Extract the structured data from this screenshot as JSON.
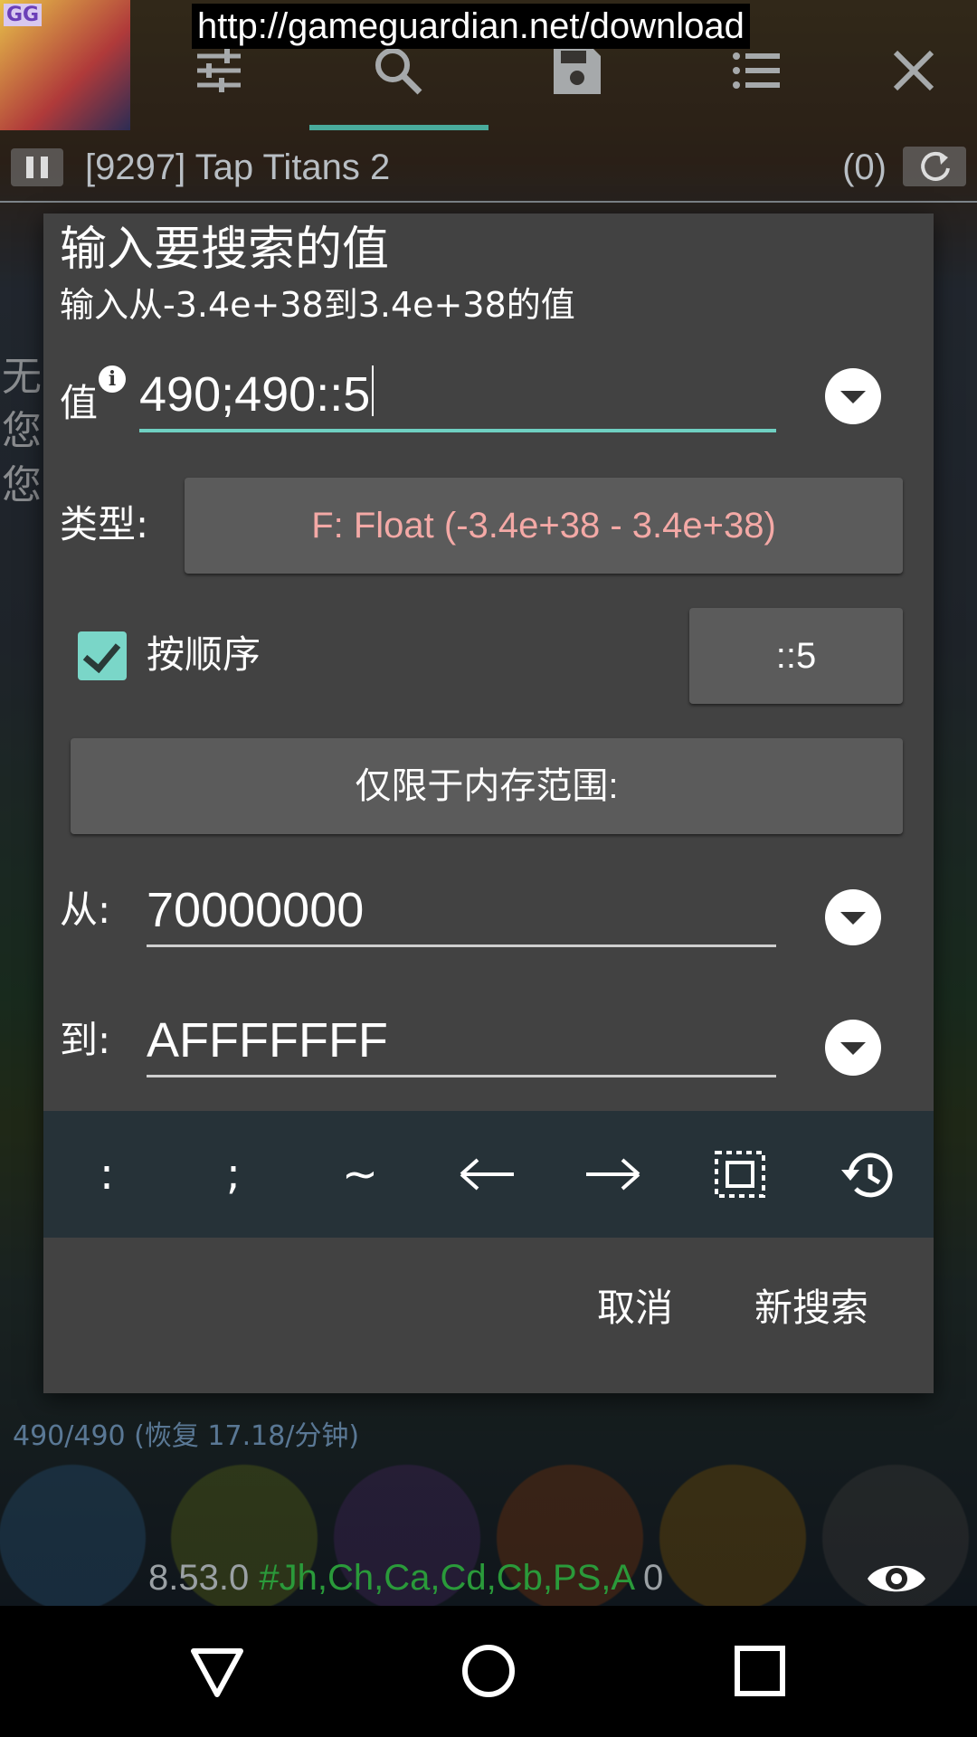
{
  "overlay": {
    "url_banner": "http://gameguardian.net/download",
    "gg_badge": "GG"
  },
  "toolbar": {
    "icons": [
      "sliders-icon",
      "search-icon",
      "save-icon",
      "list-icon",
      "close-icon"
    ]
  },
  "process": {
    "title": "[9297] Tap Titans 2",
    "result_count": "(0)"
  },
  "background": {
    "side_text": [
      "无",
      "您",
      "您"
    ],
    "energy": "490/490  (恢复 17.18/分钟)"
  },
  "dialog": {
    "title": "输入要搜索的值",
    "subtitle": "输入从-3.4e+38到3.4e+38的值",
    "value_label": "值",
    "value_input": "490;490::5",
    "type_label": "类型:",
    "type_value": "F: Float (-3.4e+38 - 3.4e+38)",
    "ordered_label": "按顺序",
    "ordered_checked": true,
    "distance_value": "::5",
    "memory_range_label": "仅限于内存范围:",
    "from_label": "从:",
    "from_value": "70000000",
    "to_label": "到:",
    "to_value": "AFFFFFFF",
    "keys": [
      ":",
      ";",
      "~"
    ],
    "cancel_label": "取消",
    "new_search_label": "新搜索"
  },
  "status": {
    "version": "8.53.0",
    "hash": "#",
    "flags": "Jh,Ch,Ca,Cd,Cb,PS,A",
    "zero": "0"
  },
  "colors": {
    "accent": "#6fd0c2",
    "dialog_bg": "#424242",
    "type_text": "#f4a9a6",
    "keybar_bg": "#263238"
  }
}
